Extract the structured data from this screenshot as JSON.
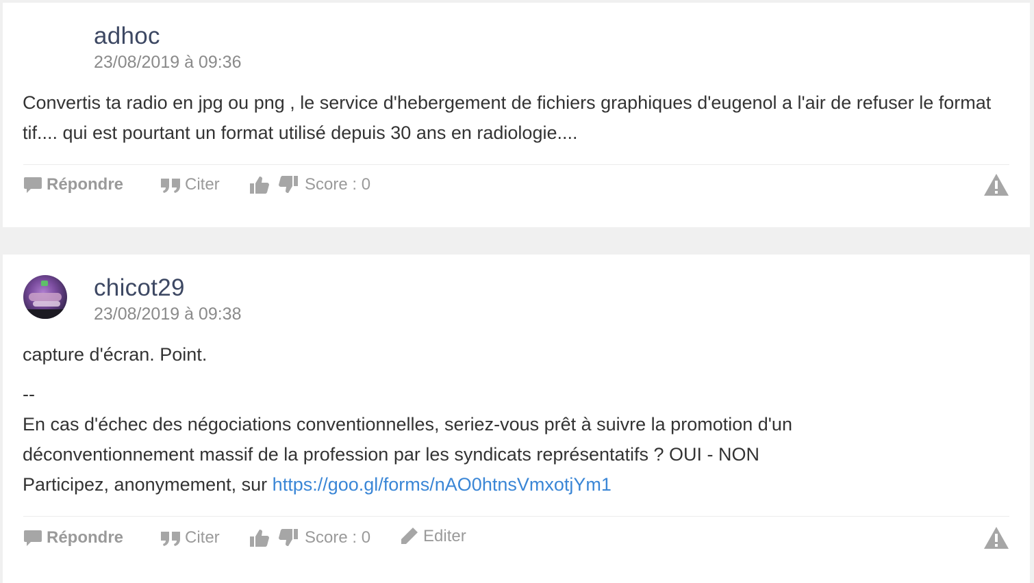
{
  "posts": [
    {
      "username": "adhoc",
      "timestamp": "23/08/2019 à 09:36",
      "body": {
        "line1": "Convertis ta radio en jpg ou png , le service d'hebergement de fichiers graphiques d'eugenol a l'air de refuser le format tif.... qui est pourtant un format utilisé depuis 30 ans en radiologie...."
      },
      "actions": {
        "reply": "Répondre",
        "quote": "Citer",
        "score": "Score : 0"
      }
    },
    {
      "username": "chicot29",
      "timestamp": "23/08/2019 à 09:38",
      "body": {
        "line1": "capture d'écran. Point.",
        "sig_sep": "--",
        "sig1": "En cas d'échec des négociations conventionnelles, seriez-vous prêt à suivre la promotion d'un déconventionnement massif de la profession par les syndicats représentatifs ? OUI - NON",
        "sig2_prefix": "Participez, anonymement, sur ",
        "sig2_link": "https://goo.gl/forms/nAO0htnsVmxotjYm1"
      },
      "actions": {
        "reply": "Répondre",
        "quote": "Citer",
        "score": "Score : 0",
        "edit": "Editer"
      }
    }
  ],
  "icons": [
    "speech-bubble-icon",
    "quote-icon",
    "thumbs-up-icon",
    "thumbs-down-icon",
    "pencil-icon",
    "warning-icon"
  ],
  "colors": {
    "username": "#3d4863",
    "link": "#3a86d6",
    "muted": "#9a9a9a",
    "background": "#f0f0f0"
  }
}
